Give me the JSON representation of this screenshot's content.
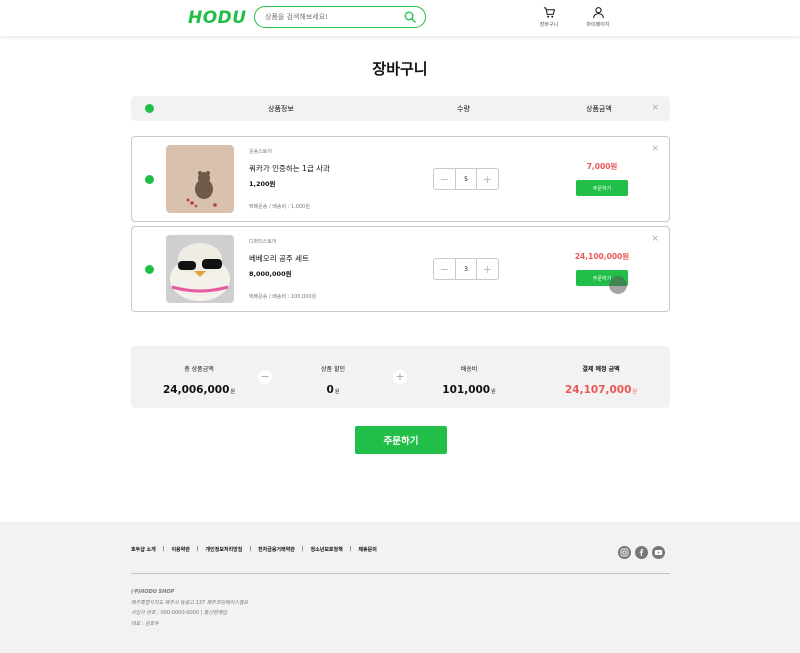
{
  "header": {
    "logo": "HODU",
    "search_placeholder": "상품을 검색해보세요!",
    "cart_label": "장바구니",
    "mypage_label": "마이페이지"
  },
  "page_title": "장바구니",
  "columns": {
    "info": "상품정보",
    "qty": "수량",
    "price": "상품금액",
    "close": "×"
  },
  "items": [
    {
      "seller": "운송스토어",
      "name": "쿼카가 인증하는 1급 사과",
      "price": "1,200원",
      "shipping": "택배운송 / 배송비 : 1,000원",
      "qty": "5",
      "total": "7,000원",
      "order_label": "주문하기",
      "close": "×"
    },
    {
      "seller": "디퍼티스토어",
      "name": "베베오리 공주 세트",
      "price": "8,000,000원",
      "shipping": "택배운송 / 배송비 : 100,000원",
      "qty": "3",
      "total": "24,100,000원",
      "order_label": "주문하기",
      "close": "×"
    }
  ],
  "summary": {
    "total_label": "총 상품금액",
    "total_value": "24,006,000",
    "discount_label": "상품 할인",
    "discount_value": "0",
    "shipping_label": "배송비",
    "shipping_value": "101,000",
    "pay_label": "결제 예정 금액",
    "pay_value": "24,107,000",
    "won": "원",
    "minus": "−",
    "plus": "+"
  },
  "checkout_label": "주문하기",
  "footer": {
    "links": [
      "호두샵 소개",
      "이용약관",
      "개인정보처리방침",
      "전자금융거래약관",
      "청소년보호정책",
      "제휴문의"
    ],
    "separator": "|",
    "company": "(주)HODU SHOP",
    "address": "제주특별자치도 제주시 동광고 137 제주코딩베이스캠프",
    "biz": "사업자 번호 : 000-0000-0000 | 통신판매업",
    "ceo": "대표 : 김호두",
    "socials": [
      "instagram-icon",
      "facebook-icon",
      "youtube-icon"
    ]
  },
  "colors": {
    "brand": "#21bf48",
    "price_red": "#eb5757"
  }
}
